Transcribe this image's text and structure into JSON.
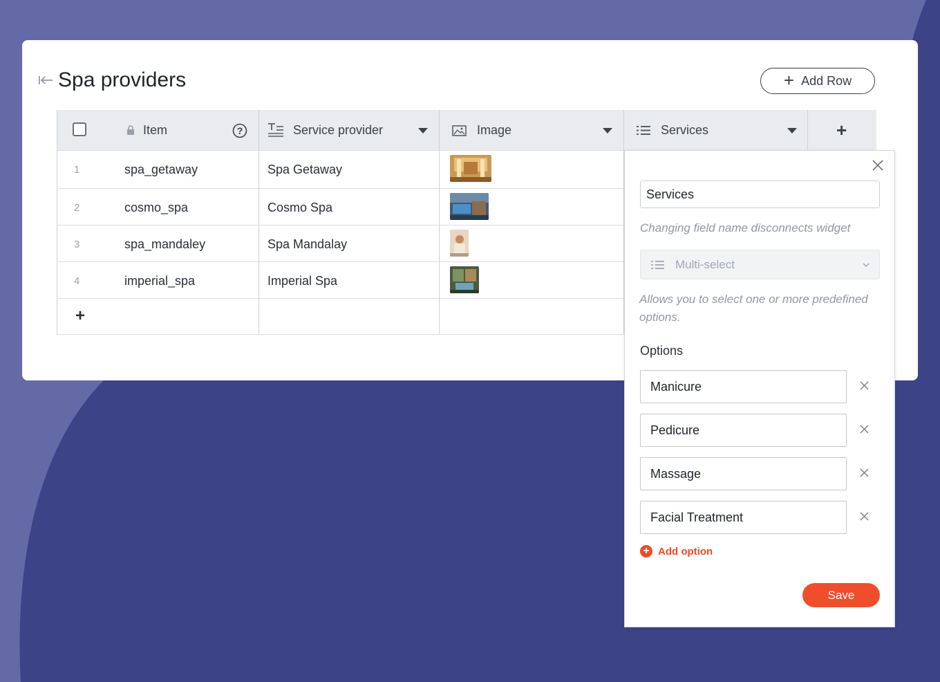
{
  "page": {
    "title": "Spa providers",
    "add_row_label": "Add Row"
  },
  "table": {
    "columns": [
      {
        "label": "Item",
        "icon": "lock-icon"
      },
      {
        "label": "Service provider",
        "icon": "text-field-icon"
      },
      {
        "label": "Image",
        "icon": "image-icon"
      },
      {
        "label": "Services",
        "icon": "list-icon"
      }
    ],
    "add_column_label": "+",
    "add_row_label": "+",
    "rows": [
      {
        "num": "1",
        "item": "spa_getaway",
        "provider": "Spa Getaway"
      },
      {
        "num": "2",
        "item": "cosmo_spa",
        "provider": "Cosmo Spa"
      },
      {
        "num": "3",
        "item": "spa_mandaley",
        "provider": "Spa Mandalay"
      },
      {
        "num": "4",
        "item": "imperial_spa",
        "provider": "Imperial Spa"
      }
    ]
  },
  "panel": {
    "field_name": "Services",
    "field_name_hint": "Changing field name disconnects widget",
    "type_value": "Multi-select",
    "type_hint": "Allows you to select one or more predefined options.",
    "options_label": "Options",
    "options": [
      "Manicure",
      "Pedicure",
      "Massage",
      "Facial Treatment"
    ],
    "add_option_label": "Add option",
    "save_label": "Save"
  },
  "colors": {
    "background": "#3c4387",
    "background_light": "#636aa6",
    "accent": "#f04d2c"
  }
}
